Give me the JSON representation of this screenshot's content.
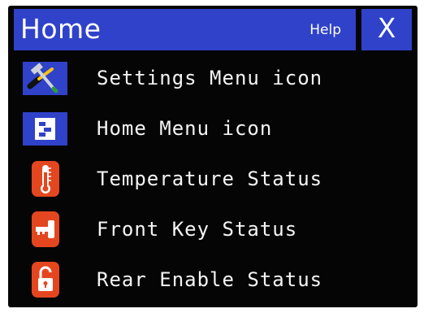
{
  "header": {
    "title": "Home",
    "help_label": "Help",
    "close_label": "X"
  },
  "menu": {
    "items": [
      {
        "label": "Settings Menu icon",
        "icon": "settings-tools-icon"
      },
      {
        "label": "Home Menu icon",
        "icon": "home-menu-icon"
      },
      {
        "label": "Temperature Status",
        "icon": "thermometer-icon"
      },
      {
        "label": "Front Key Status",
        "icon": "key-icon"
      },
      {
        "label": "Rear Enable Status",
        "icon": "unlocked-padlock-icon"
      }
    ]
  },
  "colors": {
    "screen_background": "#050506",
    "accent_blue": "#2f42c9",
    "status_orange": "#e4471f",
    "text": "#f4f4f4"
  }
}
